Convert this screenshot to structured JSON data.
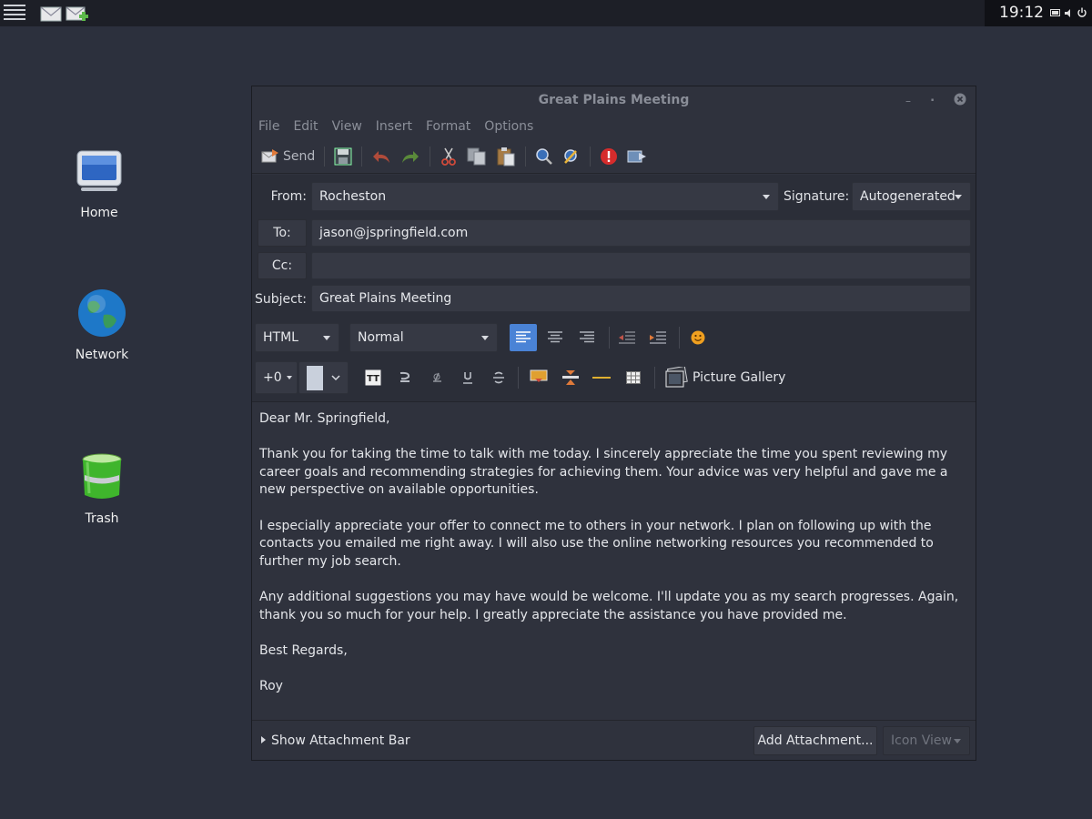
{
  "taskbar": {
    "clock": "19:12",
    "apps": [
      "mail-icon",
      "mail-compose-icon"
    ]
  },
  "desktop": {
    "icons": [
      {
        "label": "Home",
        "icon": "monitor-icon"
      },
      {
        "label": "Network",
        "icon": "globe-icon"
      },
      {
        "label": "Trash",
        "icon": "trash-icon"
      }
    ]
  },
  "window": {
    "title": "Great Plains Meeting",
    "menu": [
      "File",
      "Edit",
      "View",
      "Insert",
      "Format",
      "Options"
    ],
    "toolbar": {
      "send_label": "Send"
    },
    "from_label": "From:",
    "from_value": "Rocheston",
    "signature_label": "Signature:",
    "signature_value": "Autogenerated",
    "to_label": "To:",
    "to_value": "jason@jspringfield.com",
    "cc_label": "Cc:",
    "cc_value": "",
    "subject_label": "Subject:",
    "subject_value": "Great Plains Meeting",
    "format_mode": "HTML",
    "paragraph_style": "Normal",
    "font_size": "+0",
    "picture_gallery_label": "Picture Gallery",
    "body": [
      "Dear Mr. Springfield,",
      "Thank you for taking the time to talk with me today. I sincerely appreciate the time you spent reviewing my career goals and recommending strategies for achieving them. Your advice was very helpful and gave me a new perspective on available opportunities.",
      "I especially appreciate your offer to connect me to others in your network. I plan on following up with the contacts you emailed me right away. I will also use the online networking resources you recommended to further my job search.",
      "Any additional suggestions you may have would be welcome. I'll update you as my search progresses. Again, thank you so much for your help. I greatly appreciate the assistance you have provided me.",
      "Best Regards,",
      "Roy"
    ],
    "footer": {
      "show_attachment_bar": "Show Attachment Bar",
      "add_attachment": "Add Attachment...",
      "icon_view": "Icon View"
    }
  },
  "colors": {
    "desktop": "#2c303d",
    "active_align": "#4a83d6"
  }
}
